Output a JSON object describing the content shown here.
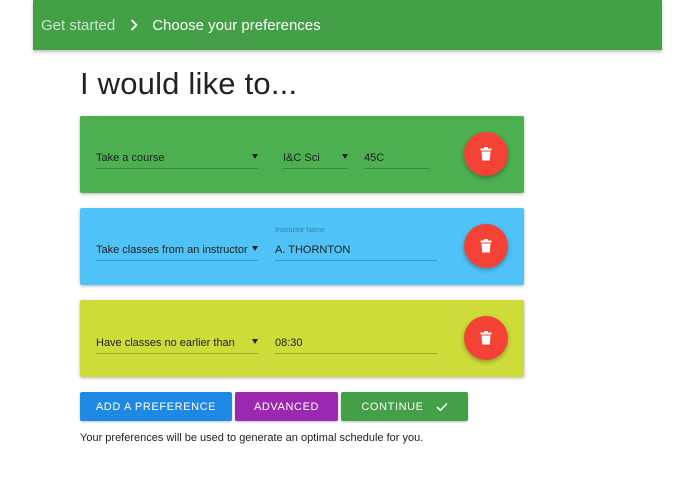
{
  "header": {
    "breadcrumb_root": "Get started",
    "breadcrumb_current": "Choose your preferences"
  },
  "page": {
    "title": "I would like to..."
  },
  "preferences": [
    {
      "type_label": "Take a course",
      "department": "I&C Sci",
      "course_number": "45C",
      "color": "#4caf50"
    },
    {
      "type_label": "Take classes from an instructor",
      "instructor_label": "Instructor Name",
      "instructor": "A. THORNTON",
      "color": "#4fc3f7"
    },
    {
      "type_label": "Have classes no earlier than",
      "time": "08:30",
      "color": "#cddc39"
    }
  ],
  "actions": {
    "add_label": "ADD A PREFERENCE",
    "advanced_label": "ADVANCED",
    "continue_label": "CONTINUE"
  },
  "footer": {
    "note": "Your preferences will be used to generate an optimal schedule for you."
  },
  "icons": {
    "breadcrumb_separator": "chevron-right-icon",
    "delete": "trash-icon",
    "dropdown": "caret-down-icon",
    "confirm": "check-icon"
  },
  "colors": {
    "app_bar": "#43a047",
    "delete_fab": "#f44336",
    "add_button": "#1e88e5",
    "advanced_button": "#9c27b0",
    "continue_button": "#43a047"
  }
}
